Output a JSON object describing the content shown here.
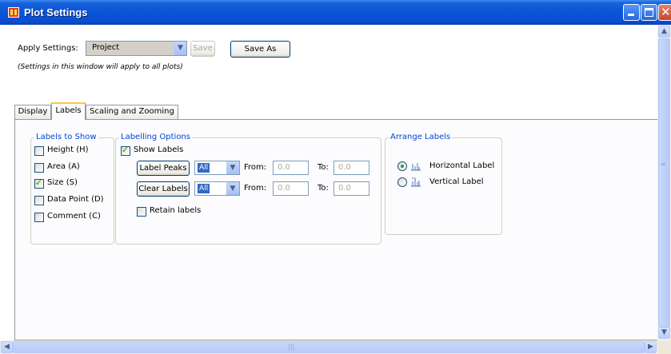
{
  "window": {
    "title": "Plot Settings"
  },
  "apply": {
    "label": "Apply Settings:",
    "selected": "Project",
    "save_label": "Save",
    "save_as_label": "Save As",
    "note": "(Settings in this window will apply to all plots)"
  },
  "tabs": [
    {
      "label": "Display"
    },
    {
      "label": "Labels",
      "active": true
    },
    {
      "label": "Scaling and Zooming"
    }
  ],
  "labels_to_show": {
    "title": "Labels to Show",
    "items": [
      {
        "label": "Height (H)",
        "checked": false
      },
      {
        "label": "Area (A)",
        "checked": false
      },
      {
        "label": "Size (S)",
        "checked": true
      },
      {
        "label": "Data Point (D)",
        "checked": false
      },
      {
        "label": "Comment (C)",
        "checked": false
      }
    ]
  },
  "labelling_options": {
    "title": "Labelling Options",
    "show_labels": {
      "label": "Show Labels",
      "checked": true
    },
    "rows": [
      {
        "button": "Label Peaks",
        "combo": "All",
        "from_label": "From:",
        "from": "0.0",
        "to_label": "To:",
        "to": "0.0"
      },
      {
        "button": "Clear Labels",
        "combo": "All",
        "from_label": "From:",
        "from": "0.0",
        "to_label": "To:",
        "to": "0.0"
      }
    ],
    "retain": {
      "label": "Retain labels",
      "checked": false
    }
  },
  "arrange_labels": {
    "title": "Arrange Labels",
    "options": [
      {
        "label": "Horizontal Label",
        "selected": true,
        "icon": "horizontal-label-icon"
      },
      {
        "label": "Vertical Label",
        "selected": false,
        "icon": "vertical-label-icon"
      }
    ]
  },
  "colors": {
    "titlebar": "#0a55d9",
    "group_title": "#0046d5",
    "check": "#21a121",
    "selection": "#316ac5"
  }
}
